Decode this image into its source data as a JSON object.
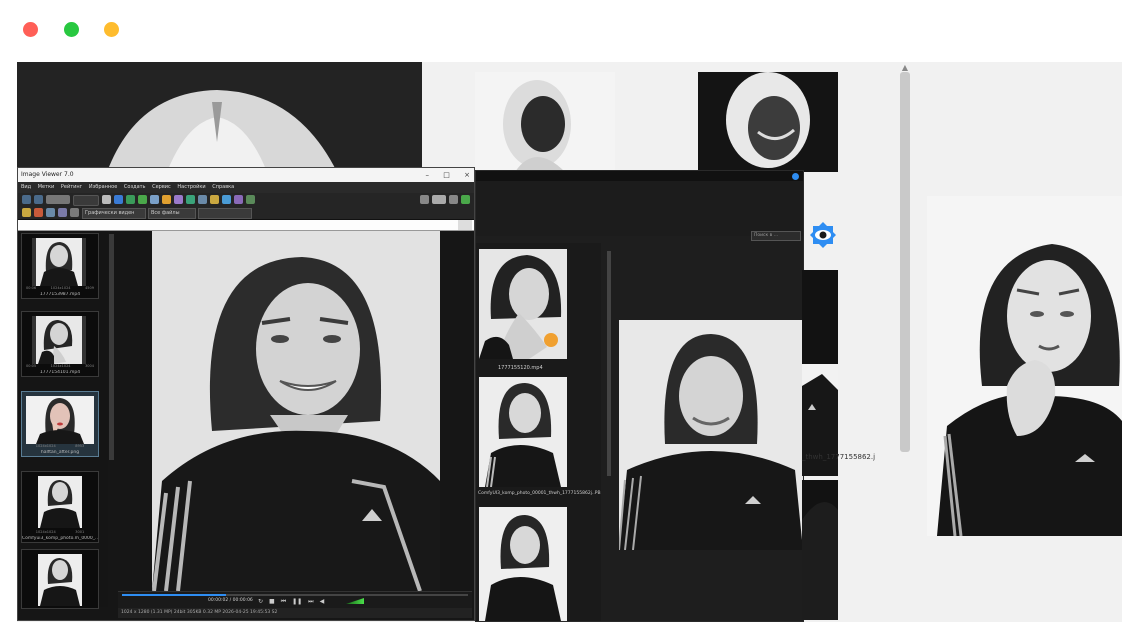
{
  "window": {
    "traffic_lights": [
      "#ff5f57",
      "#28c840",
      "#febc2e"
    ]
  },
  "viewer": {
    "title": "Image Viewer 7.0",
    "controls": [
      "–",
      "□",
      "×"
    ],
    "menu": [
      "Вид",
      "Метки",
      "Рейтинг",
      "Избранное",
      "Создать",
      "Сервис",
      "Настройки",
      "Справка"
    ],
    "sort_combo": "Графически виден",
    "filter_combo": "Все файлы",
    "search_combo": "",
    "thumbnails": [
      {
        "caption": "1777153987.mp4",
        "meta": [
          "00:06",
          "1024x1024",
          "4509"
        ],
        "kind": "video"
      },
      {
        "caption": "1777154101.mp4",
        "meta": [
          "00:05",
          "1024x1024",
          "3004"
        ],
        "kind": "video"
      },
      {
        "caption": "halftan_after.png",
        "meta": [
          "1024x1024",
          "8953"
        ],
        "kind": "image"
      },
      {
        "caption": "Comfyui3_komp_photo.m_0000_...",
        "meta": [
          "1024x1024",
          "3001"
        ],
        "kind": "image"
      },
      {
        "caption": "",
        "meta": [],
        "kind": "image"
      }
    ],
    "player_time": "00:00:02 / 00:00:06",
    "status": "1024 x 1280 (1.31 MP)   24bit 305KB   0.32 MP   2026-04-25 19:45:53 S2"
  },
  "second_window": {
    "search_placeholder": "Поиск в ...",
    "thumb_captions": [
      "1777155120.mp4",
      "ComfyUI3_komp_photo_00001_thwh_1777155862j..PB"
    ],
    "side_caption": "_thwh_1777155862.j"
  }
}
